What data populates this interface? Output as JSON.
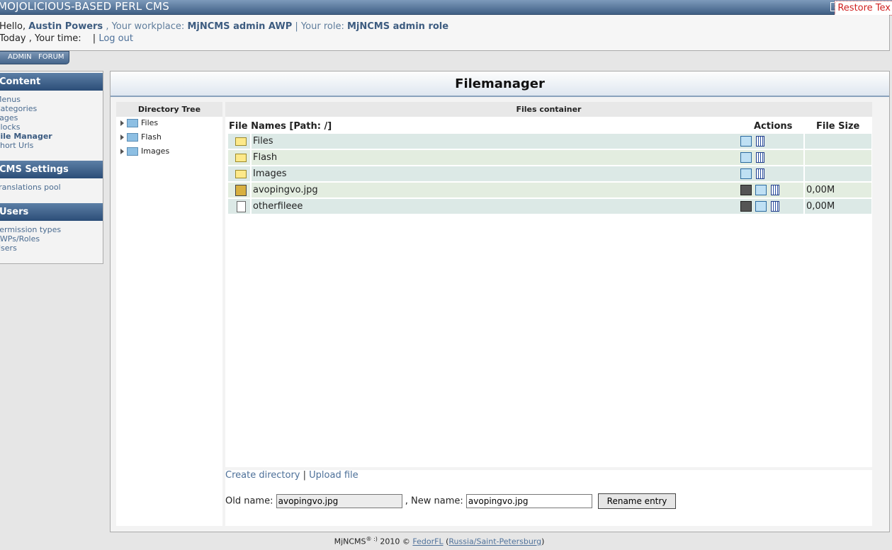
{
  "header": {
    "title": "MOJOLICIOUS-BASED PERL CMS",
    "restore_text": "Restore Tex"
  },
  "user": {
    "hello": "Hello,",
    "name": "Austin Powers",
    "workplace_label": ", Your workplace:",
    "workplace": "MjNCMS admin AWP",
    "role_label": "| Your role:",
    "role": "MjNCMS admin role",
    "today": "Today",
    "time_label": ", Your time:",
    "logout": "Log out"
  },
  "menubar": {
    "admin": "ADMIN",
    "forum": "FORUM"
  },
  "sidebar": {
    "content_title": "Content",
    "content_items": [
      "Menus",
      "Categories",
      "Pages",
      "Blocks",
      "File Manager",
      "Short Urls"
    ],
    "settings_title": "CMS Settings",
    "settings_items": [
      "Translations pool"
    ],
    "users_title": "Users",
    "users_items": [
      "Permission types",
      "AWPs/Roles",
      "Users"
    ]
  },
  "main": {
    "title": "Filemanager",
    "tree_header": "Directory Tree",
    "tree": [
      "Files",
      "Flash",
      "Images"
    ],
    "files_header": "Files container",
    "col_names": "File Names [Path: /]",
    "col_actions": "Actions",
    "col_size": "File Size",
    "rows": [
      {
        "name": "Files",
        "type": "folder",
        "size": ""
      },
      {
        "name": "Flash",
        "type": "folder",
        "size": ""
      },
      {
        "name": "Images",
        "type": "folder",
        "size": ""
      },
      {
        "name": "avopingvo.jpg",
        "type": "image",
        "size": "0,00M"
      },
      {
        "name": "otherfileee",
        "type": "file",
        "size": "0,00M"
      }
    ],
    "create_dir": "Create directory",
    "upload_file": "Upload file",
    "old_name_label": "Old name:",
    "old_name_value": "avopingvo.jpg",
    "new_name_label": ", New name:",
    "new_name_value": "avopingvo.jpg",
    "rename_button": "Rename entry"
  },
  "footer": {
    "brand": "MjNCMS",
    "year": "2010 ©",
    "author": "FedorFL",
    "location": "Russia/Saint-Petersburg"
  }
}
